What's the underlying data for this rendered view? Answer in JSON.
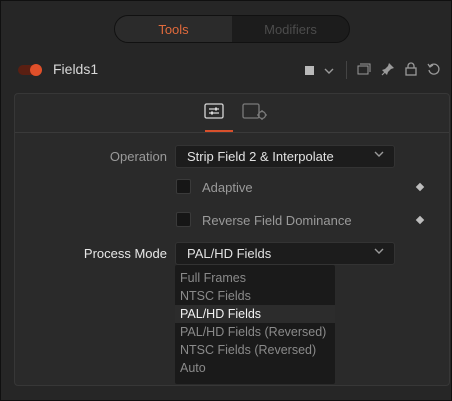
{
  "top_tabs": [
    {
      "label": "Tools",
      "active": true
    },
    {
      "label": "Modifiers",
      "active": false
    }
  ],
  "node": {
    "name": "Fields1",
    "enabled": true
  },
  "header_icons": [
    "color-swatch-icon",
    "chevron-down-icon",
    "copy-icon",
    "pin-icon",
    "lock-icon",
    "reset-icon"
  ],
  "panel_tabs": [
    "controls-tab-icon",
    "settings-tab-icon"
  ],
  "controls": {
    "operation": {
      "label": "Operation",
      "value": "Strip Field 2 & Interpolate"
    },
    "adaptive": {
      "label": "Adaptive",
      "checked": false
    },
    "reverse_field": {
      "label": "Reverse Field Dominance",
      "checked": false
    },
    "process_mode": {
      "label": "Process Mode",
      "value": "PAL/HD Fields"
    }
  },
  "process_mode_options": [
    "Full Frames",
    "NTSC Fields",
    "PAL/HD Fields",
    "PAL/HD Fields (Reversed)",
    "NTSC Fields (Reversed)",
    "Auto"
  ],
  "process_mode_selected_index": 2,
  "colors": {
    "accent": "#e06a3c",
    "background": "#262626"
  }
}
